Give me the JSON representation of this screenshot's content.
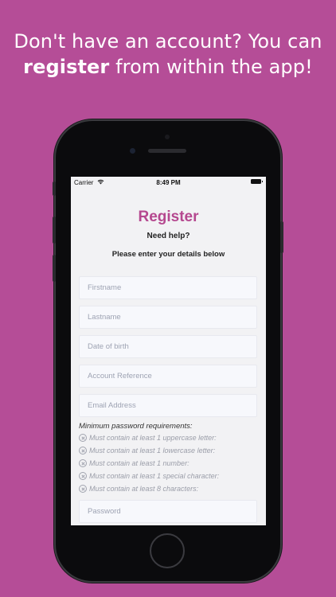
{
  "headline": {
    "line1": "Don't have an account? You can",
    "line2_bold": "register",
    "line2_rest": " from within the app!"
  },
  "statusbar": {
    "carrier": "Carrier",
    "time": "8:49 PM",
    "icons": [
      "wifi-icon",
      "battery-icon"
    ]
  },
  "form": {
    "title": "Register",
    "help_link": "Need help?",
    "instructions": "Please enter your details below",
    "fields": {
      "firstname": "Firstname",
      "lastname": "Lastname",
      "dob": "Date of birth",
      "account_ref": "Account Reference",
      "email": "Email Address",
      "password": "Password"
    },
    "password_requirements": {
      "title": "Minimum password requirements:",
      "items": [
        "Must contain at least 1 uppercase letter:",
        "Must contain at least 1 lowercase letter:",
        "Must contain at least 1 number:",
        "Must contain at least 1 special character:",
        "Must contain at least 8 characters:"
      ]
    }
  },
  "colors": {
    "background": "#b54d97",
    "title": "#b5488f"
  }
}
